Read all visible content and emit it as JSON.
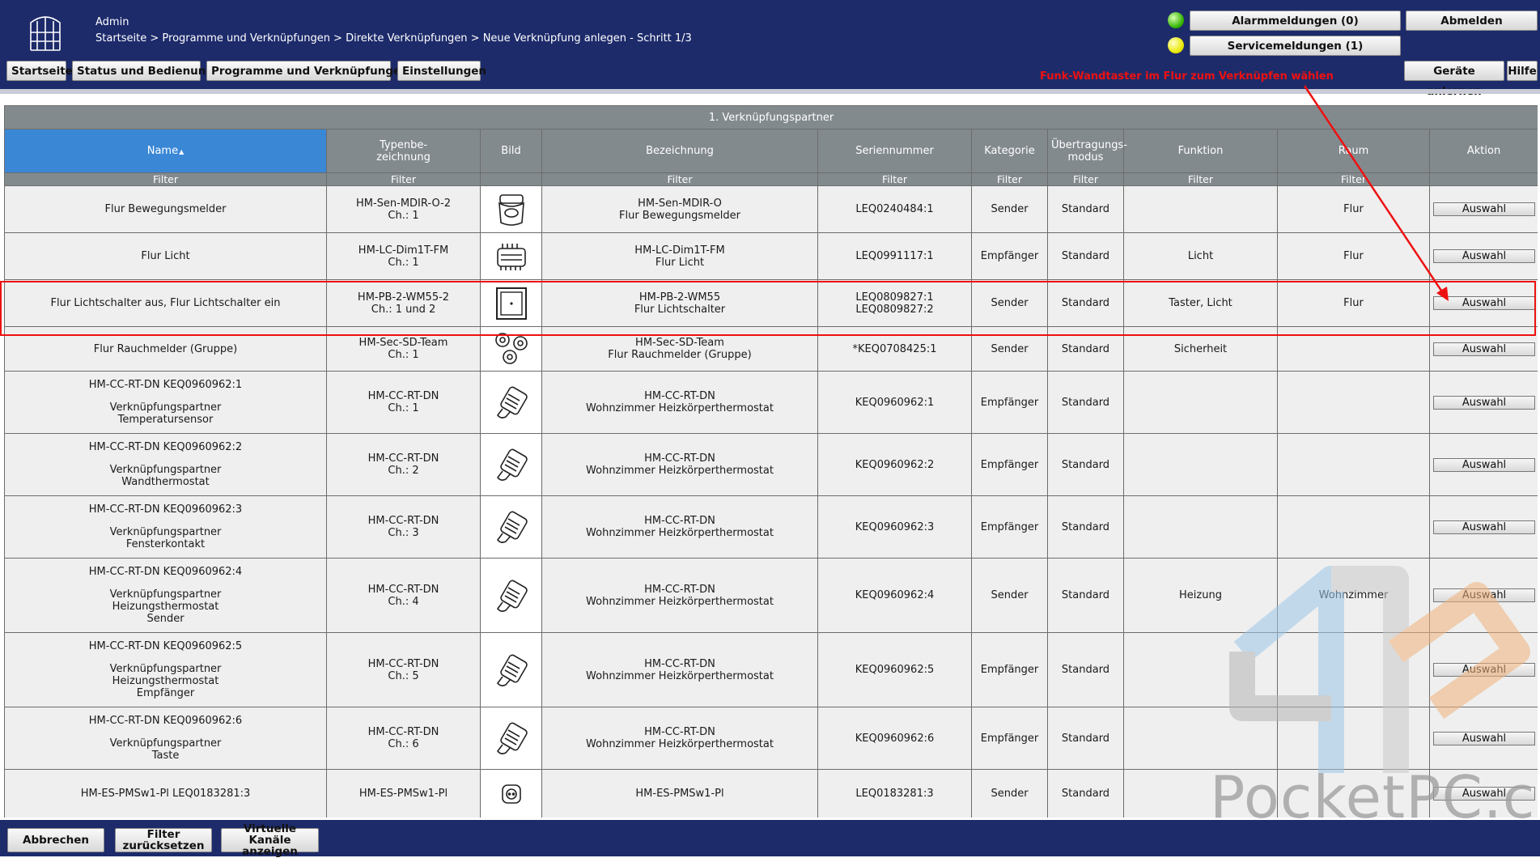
{
  "header": {
    "user": "Admin",
    "breadcrumb": "Startseite > Programme und Verknüpfungen > Direkte Verknüpfungen > Neue Verknüpfung anlegen - Schritt 1/3",
    "nav": [
      "Startseite",
      "Status und Bedienung",
      "Programme und Verknüpfungen",
      "Einstellungen"
    ],
    "alarm_label": "Alarmmeldungen (0)",
    "service_label": "Servicemeldungen (1)",
    "logout_label": "Abmelden",
    "teach_label": "Geräte anlernen",
    "help_label": "Hilfe",
    "alarm_led_color": "#33b400",
    "service_led_color": "#e8e800"
  },
  "annotation": "Funk-Wandtaster im Flur zum Verknüpfen wählen",
  "table": {
    "section_title": "1. Verknüpfungspartner",
    "filter_label": "Filter",
    "columns": [
      "Name",
      "Typenbe-\nzeichnung",
      "Bild",
      "Bezeichnung",
      "Seriennummer",
      "Kategorie",
      "Übertragungs-\nmodus",
      "Funktion",
      "Raum",
      "Aktion"
    ],
    "action_label": "Auswahl",
    "rows": [
      {
        "name": [
          "Flur Bewegungsmelder"
        ],
        "type": [
          "HM-Sen-MDIR-O-2",
          "Ch.: 1"
        ],
        "icon": "motion-sensor",
        "desc": [
          "HM-Sen-MDIR-O",
          "Flur Bewegungsmelder"
        ],
        "serial": [
          "LEQ0240484:1"
        ],
        "category": "Sender",
        "mode": "Standard",
        "function": "",
        "room": "Flur"
      },
      {
        "name": [
          "Flur Licht"
        ],
        "type": [
          "HM-LC-Dim1T-FM",
          "Ch.: 1"
        ],
        "icon": "dimmer",
        "desc": [
          "HM-LC-Dim1T-FM",
          "Flur Licht"
        ],
        "serial": [
          "LEQ0991117:1"
        ],
        "category": "Empfänger",
        "mode": "Standard",
        "function": "Licht",
        "room": "Flur"
      },
      {
        "name": [
          "Flur Lichtschalter aus, Flur Lichtschalter ein"
        ],
        "type": [
          "HM-PB-2-WM55-2",
          "Ch.: 1 und 2"
        ],
        "icon": "wall-switch",
        "desc": [
          "HM-PB-2-WM55",
          "Flur Lichtschalter"
        ],
        "serial": [
          "LEQ0809827:1",
          "LEQ0809827:2"
        ],
        "category": "Sender",
        "mode": "Standard",
        "function": "Taster, Licht",
        "room": "Flur"
      },
      {
        "name": [
          "Flur Rauchmelder (Gruppe)"
        ],
        "type": [
          "HM-Sec-SD-Team",
          "Ch.: 1"
        ],
        "icon": "smoke-detector",
        "desc": [
          "HM-Sec-SD-Team",
          "Flur Rauchmelder (Gruppe)"
        ],
        "serial": [
          "*KEQ0708425:1"
        ],
        "category": "Sender",
        "mode": "Standard",
        "function": "Sicherheit",
        "room": ""
      },
      {
        "name": [
          "HM-CC-RT-DN KEQ0960962:1",
          " ",
          "Verknüpfungspartner",
          "Temperatursensor"
        ],
        "type": [
          "HM-CC-RT-DN",
          "Ch.: 1"
        ],
        "icon": "thermostat",
        "desc": [
          "HM-CC-RT-DN",
          "Wohnzimmer Heizkörperthermostat"
        ],
        "serial": [
          "KEQ0960962:1"
        ],
        "category": "Empfänger",
        "mode": "Standard",
        "function": "",
        "room": ""
      },
      {
        "name": [
          "HM-CC-RT-DN KEQ0960962:2",
          " ",
          "Verknüpfungspartner",
          "Wandthermostat"
        ],
        "type": [
          "HM-CC-RT-DN",
          "Ch.: 2"
        ],
        "icon": "thermostat",
        "desc": [
          "HM-CC-RT-DN",
          "Wohnzimmer Heizkörperthermostat"
        ],
        "serial": [
          "KEQ0960962:2"
        ],
        "category": "Empfänger",
        "mode": "Standard",
        "function": "",
        "room": ""
      },
      {
        "name": [
          "HM-CC-RT-DN KEQ0960962:3",
          " ",
          "Verknüpfungspartner",
          "Fensterkontakt"
        ],
        "type": [
          "HM-CC-RT-DN",
          "Ch.: 3"
        ],
        "icon": "thermostat",
        "desc": [
          "HM-CC-RT-DN",
          "Wohnzimmer Heizkörperthermostat"
        ],
        "serial": [
          "KEQ0960962:3"
        ],
        "category": "Empfänger",
        "mode": "Standard",
        "function": "",
        "room": ""
      },
      {
        "name": [
          "HM-CC-RT-DN KEQ0960962:4",
          " ",
          "Verknüpfungspartner",
          "Heizungsthermostat",
          "Sender"
        ],
        "type": [
          "HM-CC-RT-DN",
          "Ch.: 4"
        ],
        "icon": "thermostat",
        "desc": [
          "HM-CC-RT-DN",
          "Wohnzimmer Heizkörperthermostat"
        ],
        "serial": [
          "KEQ0960962:4"
        ],
        "category": "Sender",
        "mode": "Standard",
        "function": "Heizung",
        "room": "Wohnzimmer"
      },
      {
        "name": [
          "HM-CC-RT-DN KEQ0960962:5",
          " ",
          "Verknüpfungspartner",
          "Heizungsthermostat",
          "Empfänger"
        ],
        "type": [
          "HM-CC-RT-DN",
          "Ch.: 5"
        ],
        "icon": "thermostat",
        "desc": [
          "HM-CC-RT-DN",
          "Wohnzimmer Heizkörperthermostat"
        ],
        "serial": [
          "KEQ0960962:5"
        ],
        "category": "Empfänger",
        "mode": "Standard",
        "function": "",
        "room": ""
      },
      {
        "name": [
          "HM-CC-RT-DN KEQ0960962:6",
          " ",
          "Verknüpfungspartner",
          "Taste"
        ],
        "type": [
          "HM-CC-RT-DN",
          "Ch.: 6"
        ],
        "icon": "thermostat",
        "desc": [
          "HM-CC-RT-DN",
          "Wohnzimmer Heizkörperthermostat"
        ],
        "serial": [
          "KEQ0960962:6"
        ],
        "category": "Empfänger",
        "mode": "Standard",
        "function": "",
        "room": ""
      },
      {
        "name": [
          "HM-ES-PMSw1-Pl LEQ0183281:3"
        ],
        "type": [
          "HM-ES-PMSw1-Pl"
        ],
        "icon": "power-plug",
        "desc": [
          "HM-ES-PMSw1-Pl"
        ],
        "serial": [
          "LEQ0183281:3"
        ],
        "category": "Sender",
        "mode": "Standard",
        "function": "",
        "room": ""
      }
    ]
  },
  "footer": {
    "cancel_label": "Abbrechen",
    "reset_filter_label": "Filter\nzurücksetzen",
    "virtual_channels_label": "Virtuelle Kanäle\nanzeigen"
  },
  "watermark": "PocketPC.ch"
}
